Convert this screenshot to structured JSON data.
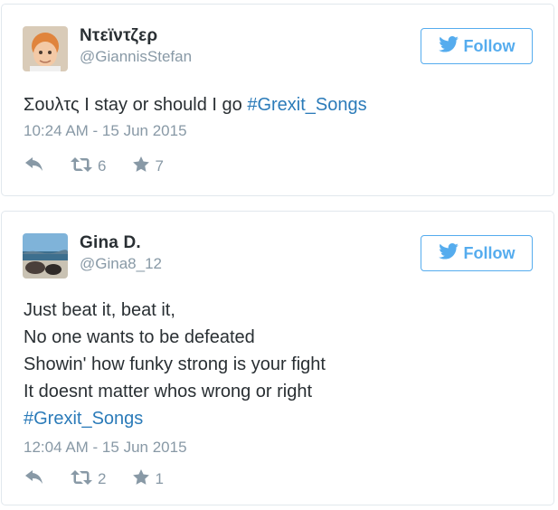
{
  "tweets": [
    {
      "display_name": "Ντεϊντζερ",
      "handle": "@GiannisStefan",
      "text_plain": "Σουλτς I stay or should I go ",
      "hashtag": "#Grexit_Songs",
      "timestamp": "10:24 AM - 15 Jun 2015",
      "retweets": "6",
      "favorites": "7",
      "follow_label": "Follow"
    },
    {
      "display_name": "Gina D.",
      "handle": "@Gina8_12",
      "lines": [
        "Just beat it, beat it,",
        "No one wants to be defeated",
        "Showin' how funky strong is your fight",
        "It doesnt matter whos wrong or right"
      ],
      "hashtag": "#Grexit_Songs",
      "timestamp": "12:04 AM - 15 Jun 2015",
      "retweets": "2",
      "favorites": "1",
      "follow_label": "Follow"
    }
  ],
  "colors": {
    "accent": "#55acee",
    "hashtag": "#2b7bb9",
    "muted": "#8899a6",
    "text": "#292f33",
    "border": "#e1e8ed"
  },
  "icons": [
    "twitter-bird-icon",
    "reply-icon",
    "retweet-icon",
    "favorite-star-icon"
  ]
}
